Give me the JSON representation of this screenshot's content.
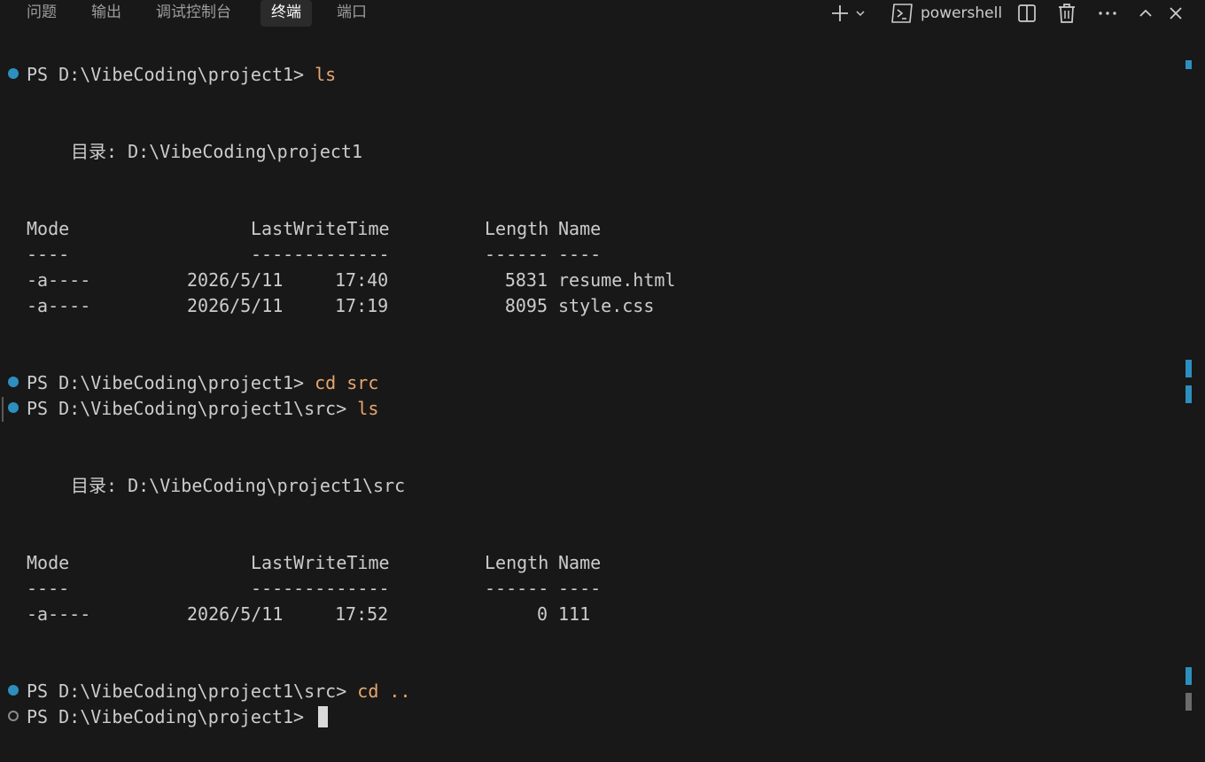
{
  "tabs": [
    {
      "label": "问题"
    },
    {
      "label": "输出"
    },
    {
      "label": "调试控制台"
    },
    {
      "label": "终端"
    },
    {
      "label": "端口"
    }
  ],
  "active_tab": "终端",
  "toolbar": {
    "profile_label": "powershell",
    "icons": [
      "plus-icon",
      "chevron-down-icon",
      "terminal-icon",
      "split-editor-icon",
      "trash-icon",
      "ellipsis-icon",
      "chevron-up-icon",
      "close-icon"
    ]
  },
  "terminal": {
    "prompt1": "PS D:\\VibeCoding\\project1> ",
    "cmd1": "ls",
    "dir_header1": "目录: D:\\VibeCoding\\project1",
    "col_mode": "Mode",
    "col_lwt": "LastWriteTime",
    "col_len": "Length",
    "col_name": "Name",
    "sep_mode": "----",
    "sep_lwt": "-------------",
    "sep_len": "------",
    "sep_name": "----",
    "rows1": [
      {
        "mode": "-a----",
        "date": "2026/5/11",
        "time": "17:40",
        "length": "5831",
        "name": "resume.html"
      },
      {
        "mode": "-a----",
        "date": "2026/5/11",
        "time": "17:19",
        "length": "8095",
        "name": "style.css"
      }
    ],
    "prompt2": "PS D:\\VibeCoding\\project1> ",
    "cmd2": "cd src",
    "prompt3": "PS D:\\VibeCoding\\project1\\src> ",
    "cmd3": "ls",
    "dir_header2": "目录: D:\\VibeCoding\\project1\\src",
    "rows2": [
      {
        "mode": "-a----",
        "date": "2026/5/11",
        "time": "17:52",
        "length": "0",
        "name": "111"
      }
    ],
    "prompt4": "PS D:\\VibeCoding\\project1\\src> ",
    "cmd4": "cd ..",
    "prompt5": "PS D:\\VibeCoding\\project1> "
  },
  "colors": {
    "background": "#181818",
    "text": "#cccccc",
    "command": "#e9a76e",
    "decoration": "#2d8fbf"
  }
}
